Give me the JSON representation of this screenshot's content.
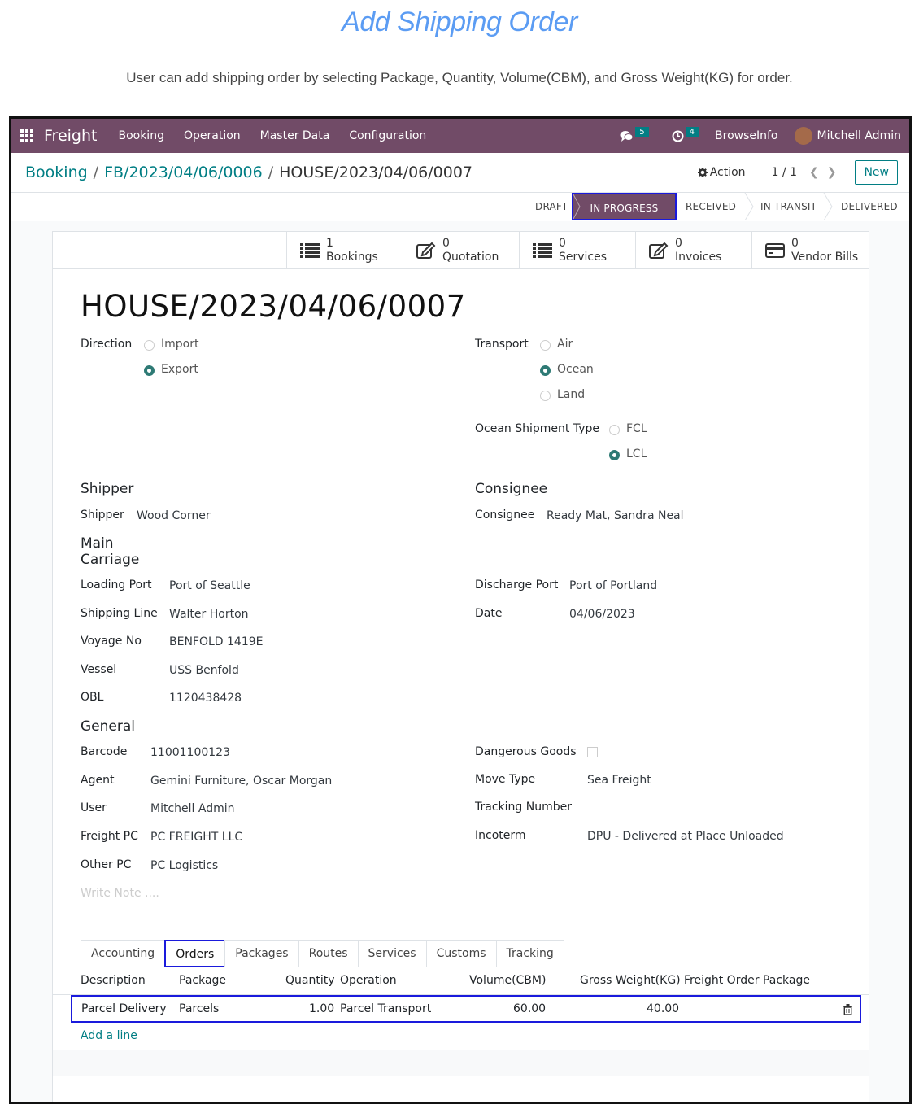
{
  "doc": {
    "title": "Add Shipping Order",
    "subtitle": "User can add shipping order by selecting Package, Quantity, Volume(CBM), and Gross Weight(KG) for order."
  },
  "navbar": {
    "brand": "Freight",
    "menus": [
      "Booking",
      "Operation",
      "Master Data",
      "Configuration"
    ],
    "messages_count": "5",
    "activities_count": "4",
    "company": "BrowseInfo",
    "user": "Mitchell Admin"
  },
  "breadcrumb": {
    "root": "Booking",
    "parent": "FB/2023/04/06/0006",
    "current": "HOUSE/2023/04/06/0007",
    "sep": "/"
  },
  "controls": {
    "action": "Action",
    "pager": "1 / 1",
    "new": "New"
  },
  "stages": [
    "DRAFT",
    "IN PROGRESS",
    "RECEIVED",
    "IN TRANSIT",
    "DELIVERED"
  ],
  "active_stage": "IN PROGRESS",
  "smart_buttons": [
    {
      "count": "1",
      "label": "Bookings",
      "icon": "list-icon"
    },
    {
      "count": "0",
      "label": "Quotation",
      "icon": "edit-icon"
    },
    {
      "count": "0",
      "label": "Services",
      "icon": "list-icon"
    },
    {
      "count": "0",
      "label": "Invoices",
      "icon": "edit-icon"
    },
    {
      "count": "0",
      "label": "Vendor Bills",
      "icon": "credit-card-icon"
    }
  ],
  "record": {
    "title": "HOUSE/2023/04/06/0007",
    "direction": {
      "label": "Direction",
      "options": [
        "Import",
        "Export"
      ],
      "selected": "Export"
    },
    "transport": {
      "label": "Transport",
      "options": [
        "Air",
        "Ocean",
        "Land"
      ],
      "selected": "Ocean"
    },
    "ocean_type": {
      "label": "Ocean Shipment Type",
      "options": [
        "FCL",
        "LCL"
      ],
      "selected": "LCL"
    },
    "shipper_section": "Shipper",
    "shipper_label": "Shipper",
    "shipper": "Wood Corner",
    "consignee_section": "Consignee",
    "consignee_label": "Consignee",
    "consignee": "Ready Mat, Sandra Neal",
    "main_carriage_line1": "Main",
    "main_carriage_line2": "Carriage",
    "loading_port_label": "Loading Port",
    "loading_port": "Port of Seattle",
    "shipping_line_label": "Shipping Line",
    "shipping_line": "Walter Horton",
    "voyage_label": "Voyage No",
    "voyage": "BENFOLD 1419E",
    "vessel_label": "Vessel",
    "vessel": "USS Benfold",
    "obl_label": "OBL",
    "obl": "1120438428",
    "discharge_port_label": "Discharge Port",
    "discharge_port": "Port of Portland",
    "date_label": "Date",
    "date": "04/06/2023",
    "general_section": "General",
    "barcode_label": "Barcode",
    "barcode": "11001100123",
    "agent_label": "Agent",
    "agent": "Gemini Furniture, Oscar Morgan",
    "user_label": "User",
    "user": "Mitchell Admin",
    "freight_pc_label": "Freight PC",
    "freight_pc": "PC FREIGHT LLC",
    "other_pc_label": "Other PC",
    "other_pc": "PC Logistics",
    "dangerous_label": "Dangerous Goods",
    "move_type_label": "Move Type",
    "move_type": "Sea Freight",
    "tracking_label": "Tracking Number",
    "incoterm_label": "Incoterm",
    "incoterm": "DPU - Delivered at Place Unloaded",
    "note_placeholder": "Write Note ...."
  },
  "tabs": [
    "Accounting",
    "Orders",
    "Packages",
    "Routes",
    "Services",
    "Customs",
    "Tracking"
  ],
  "active_tab": "Orders",
  "orders": {
    "columns": [
      "Description",
      "Package",
      "Quantity",
      "Operation",
      "Volume(CBM)",
      "Gross Weight(KG)",
      "Freight Order Package"
    ],
    "rows": [
      {
        "description": "Parcel Delivery",
        "package": "Parcels",
        "quantity": "1.00",
        "operation": "Parcel Transport",
        "volume": "60.00",
        "weight": "40.00",
        "freight_package": ""
      }
    ],
    "add_line": "Add a line"
  }
}
